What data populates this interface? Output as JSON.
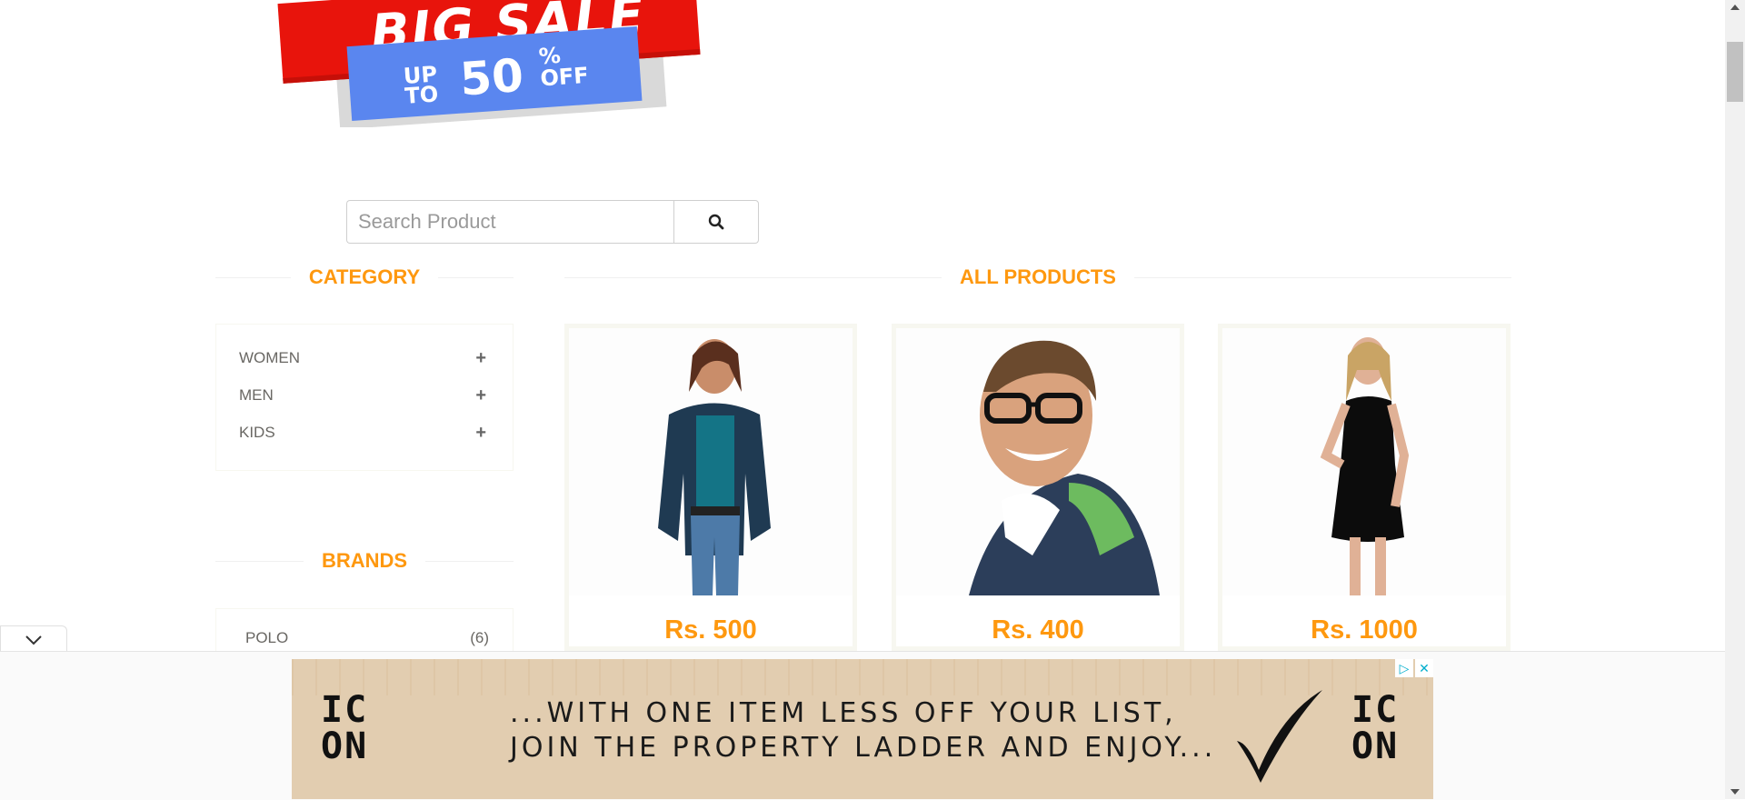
{
  "banner": {
    "headline": "BIG SALE",
    "upto": "UP TO",
    "discount": "50",
    "off": "% OFF"
  },
  "search": {
    "placeholder": "Search Product",
    "button_icon": "search-icon"
  },
  "sidebar": {
    "category_title": "CATEGORY",
    "categories": [
      {
        "label": "WOMEN",
        "icon": "plus-icon"
      },
      {
        "label": "MEN",
        "icon": "plus-icon"
      },
      {
        "label": "KIDS",
        "icon": "plus-icon"
      }
    ],
    "brands_title": "BRANDS",
    "brands": [
      {
        "label": "POLO",
        "count": "(6)"
      }
    ]
  },
  "main": {
    "title": "ALL PRODUCTS",
    "products": [
      {
        "price": "Rs. 500",
        "image": "woman-in-teal-top"
      },
      {
        "price": "Rs. 400",
        "image": "smiling-man-with-glasses"
      },
      {
        "price": "Rs. 1000",
        "image": "woman-in-black-dress"
      }
    ]
  },
  "ad": {
    "logo_left": "IC ON",
    "line1": "...WITH ONE ITEM LESS OFF YOUR LIST,",
    "line2": "JOIN THE PROPERTY LADDER AND ENJOY...",
    "logo_right": "IC ON",
    "adchoices_icon": "adchoices-icon",
    "close_icon": "close-icon",
    "collapse_icon": "chevron-down-icon"
  },
  "colors": {
    "accent": "#fe980f",
    "text": "#696763",
    "sale_red": "#e8140c",
    "sale_blue": "#5a86ef"
  }
}
